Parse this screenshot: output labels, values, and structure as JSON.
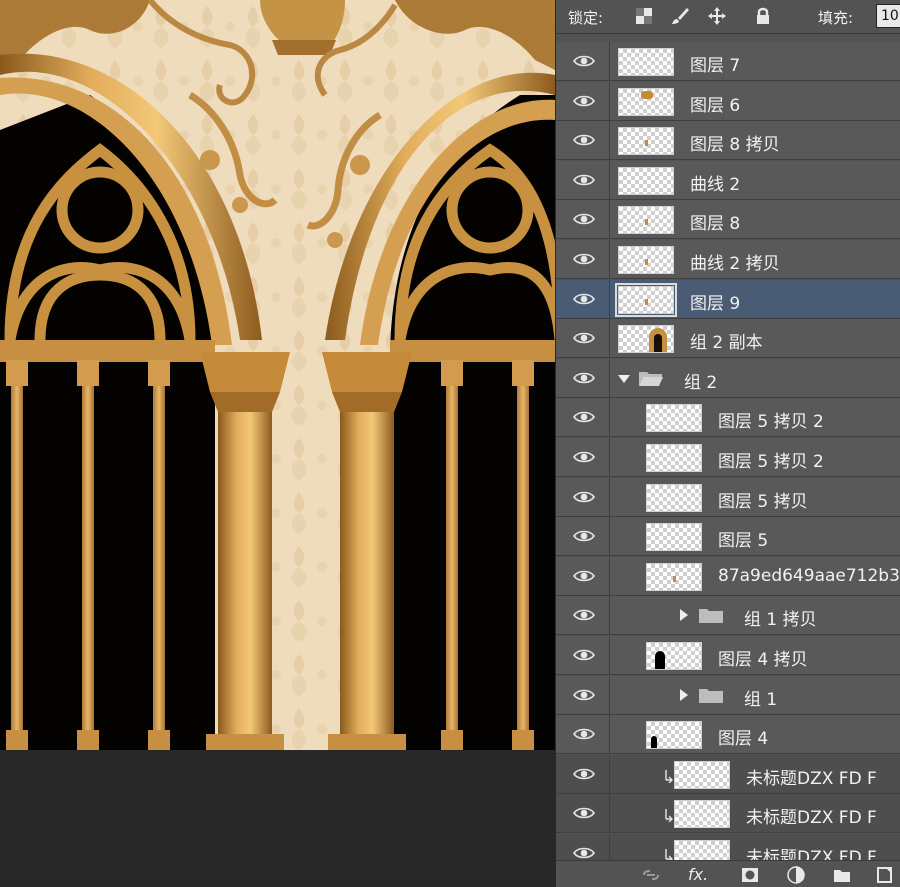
{
  "panel": {
    "lock_label": "锁定:",
    "fill_label": "填充:",
    "fill_value": "10",
    "icons": [
      "lock-transparent-pixels-icon",
      "lock-image-pixels-brush-icon",
      "lock-position-move-icon",
      "lock-all-padlock-icon"
    ]
  },
  "layers": [
    {
      "name": "图层 7",
      "indent": 0,
      "thumb": "transparent",
      "selected": false
    },
    {
      "name": "图层 6",
      "indent": 0,
      "thumb": "transparent-gold-top",
      "selected": false
    },
    {
      "name": "图层 8 拷贝",
      "indent": 0,
      "thumb": "transparent-gold-dot",
      "selected": false
    },
    {
      "name": "曲线 2",
      "indent": 0,
      "thumb": "transparent",
      "selected": false
    },
    {
      "name": "图层 8",
      "indent": 0,
      "thumb": "transparent-gold-dot",
      "selected": false
    },
    {
      "name": "曲线 2 拷贝",
      "indent": 0,
      "thumb": "transparent-gold-dot",
      "selected": false
    },
    {
      "name": "图层 9",
      "indent": 0,
      "thumb": "transparent-gold-dot",
      "selected": true
    },
    {
      "name": "组 2 副本",
      "indent": 0,
      "thumb": "arch",
      "selected": false
    },
    {
      "name": "组 2",
      "indent": 0,
      "type": "group-open",
      "selected": false
    },
    {
      "name": "图层 5 拷贝 2",
      "indent": 1,
      "thumb": "transparent",
      "selected": false
    },
    {
      "name": "图层 5 拷贝 2",
      "indent": 1,
      "thumb": "transparent",
      "selected": false
    },
    {
      "name": "图层 5 拷贝",
      "indent": 1,
      "thumb": "transparent",
      "selected": false
    },
    {
      "name": "图层 5",
      "indent": 1,
      "thumb": "transparent",
      "selected": false
    },
    {
      "name": "87a9ed649aae712b3",
      "indent": 1,
      "thumb": "transparent-gold-dot",
      "selected": false
    },
    {
      "name": "组 1 拷贝",
      "indent": 1,
      "type": "group-closed",
      "selected": false
    },
    {
      "name": "图层 4 拷贝",
      "indent": 1,
      "thumb": "black-shape",
      "selected": false
    },
    {
      "name": "组 1",
      "indent": 1,
      "type": "group-closed",
      "selected": false
    },
    {
      "name": "图层 4",
      "indent": 1,
      "thumb": "black-shape-small",
      "selected": false
    },
    {
      "name": "未标题DZX FD F",
      "indent": 2,
      "thumb": "transparent",
      "clip": true,
      "selected": false
    },
    {
      "name": "未标题DZX FD F",
      "indent": 2,
      "thumb": "transparent",
      "clip": true,
      "selected": false
    },
    {
      "name": "未标题DZX FD F",
      "indent": 2,
      "thumb": "transparent",
      "clip": true,
      "selected": false
    }
  ],
  "footer": {
    "icons": [
      "link-layers-icon",
      "fx-icon",
      "add-mask-icon",
      "adjustment-layer-icon",
      "new-group-icon",
      "new-layer-icon"
    ],
    "fx_label": "fx."
  },
  "colors": {
    "panel_bg": "#535353",
    "row_bg": "#595959",
    "selected_row": "#4a5c73",
    "canvas_bg": "#282828",
    "gold": "#c08a3a",
    "wall": "#f0dcbc"
  }
}
